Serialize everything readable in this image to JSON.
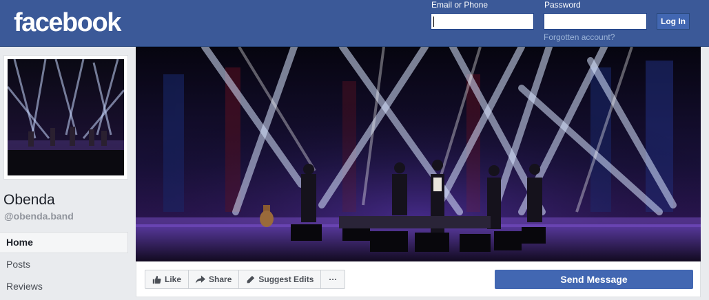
{
  "header": {
    "logo_text": "facebook",
    "email_label": "Email or Phone",
    "password_label": "Password",
    "email_value": "",
    "password_value": "",
    "login_label": "Log In",
    "forgot_label": "Forgotten account?"
  },
  "page": {
    "name": "Obenda",
    "handle": "@obenda.band"
  },
  "nav": {
    "items": [
      {
        "label": "Home",
        "active": true
      },
      {
        "label": "Posts",
        "active": false
      },
      {
        "label": "Reviews",
        "active": false
      }
    ]
  },
  "actions": {
    "like_label": "Like",
    "share_label": "Share",
    "suggest_label": "Suggest Edits",
    "more_label": "···",
    "send_label": "Send Message"
  },
  "icons": {
    "like": "thumbs-up-icon",
    "share": "share-arrow-icon",
    "suggest": "pencil-icon",
    "more": "more-icon"
  },
  "colors": {
    "brand": "#3b5998",
    "button_blue": "#4267b2",
    "background": "#e9ebee"
  }
}
